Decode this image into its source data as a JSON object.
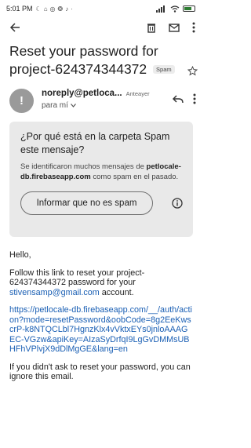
{
  "status_bar": {
    "time": "5:01 PM",
    "icons": [
      "notification-icon",
      "app-icon",
      "app-icon",
      "app-icon",
      "app-icon"
    ]
  },
  "toolbar": {
    "back_icon": "arrow-back-icon",
    "delete_icon": "delete-icon",
    "mark_unread_icon": "mail-icon",
    "more_icon": "more-vertical-icon"
  },
  "email": {
    "subject": "Reset your password for project-624374344372",
    "label": "Spam",
    "sender_name": "noreply@petloca...",
    "time": "Anteayer",
    "recipient": "para mí"
  },
  "spam_notice": {
    "title": "¿Por qué está en la carpeta Spam este mensaje?",
    "desc_prefix": "Se identificaron muchos mensajes de ",
    "domain": "petlocale-db.firebaseapp.com",
    "desc_suffix": " como spam en el pasado.",
    "button": "Informar que no es spam"
  },
  "body": {
    "greeting": "Hello,",
    "para1_a": "Follow this link to reset your project-624374344372 password for your ",
    "email_link": "stivensamp@gmail.com",
    "para1_b": " account.",
    "url": "https://petlocale-db.firebaseapp.com/__/auth/action?mode=resetPassword&oobCode=8g2EeKwscrP-k8NTQCLbl7HgnzKlx4vVktxEYs0jnloAAAGEC-VGzw&apiKey=AIzaSyDrfqI9LgGvDMMsUBHFhVPlvjX9dDlMgGE&lang=en",
    "para3": "If you didn't ask to reset your password, you can ignore this email."
  }
}
